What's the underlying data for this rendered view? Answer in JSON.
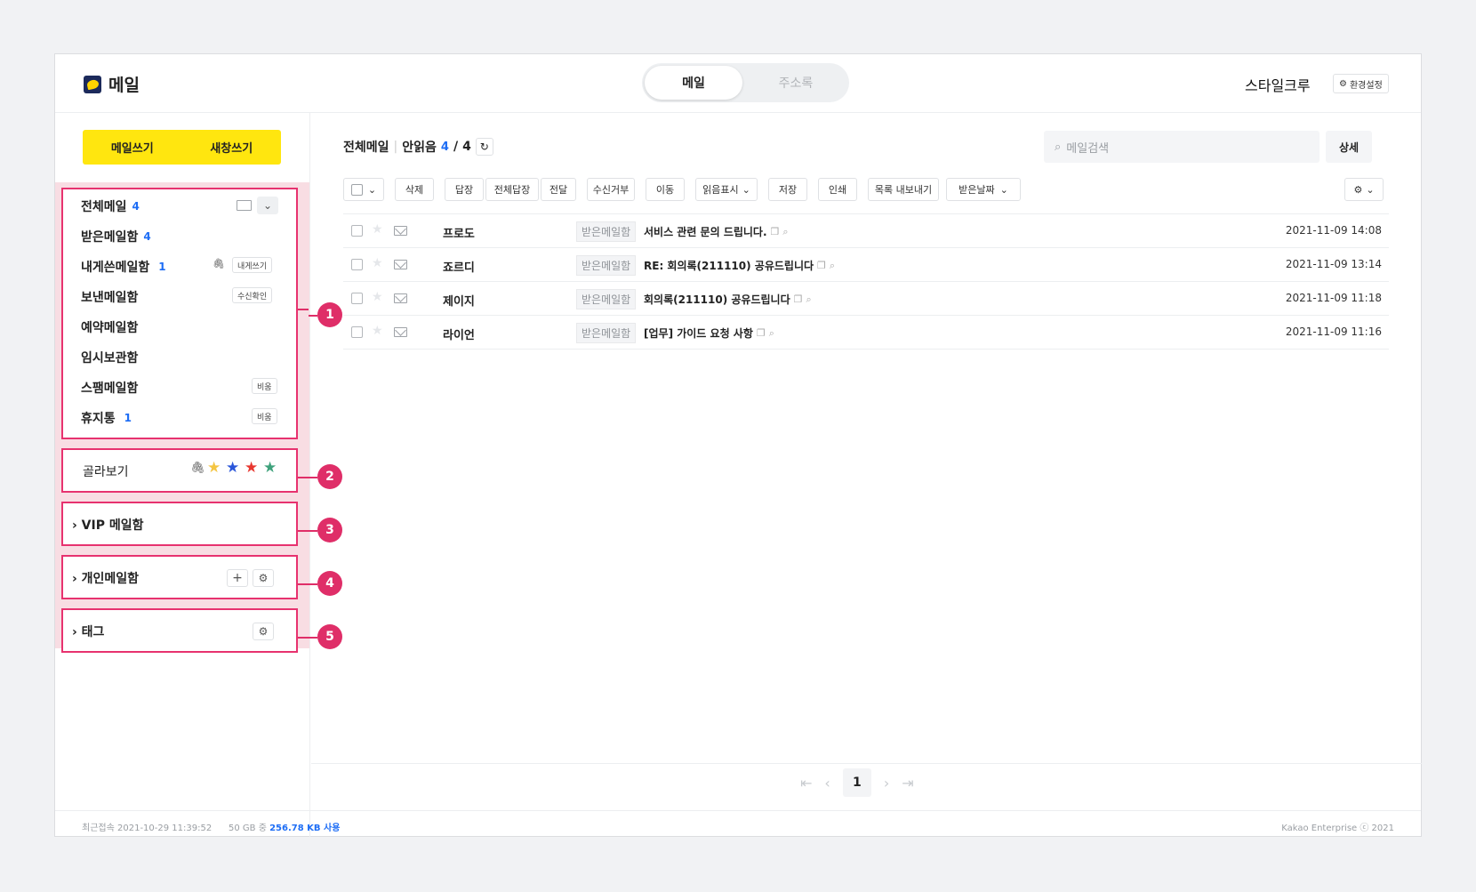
{
  "app": {
    "title": "메일"
  },
  "topnav": {
    "tab_active": "메일",
    "tab_inactive": "주소록"
  },
  "user": {
    "name": "스타일크루",
    "settings_label": "환경설정"
  },
  "compose": {
    "write": "메일쓰기",
    "popup": "새창쓰기"
  },
  "folders": [
    {
      "label": "전체메일",
      "count": "4"
    },
    {
      "label": "받은메일함",
      "count": "4"
    },
    {
      "label": "내게쓴메일함",
      "count": "1",
      "chip": "내게쓰기"
    },
    {
      "label": "보낸메일함",
      "count": "",
      "chip": "수신확인"
    },
    {
      "label": "예약메일함",
      "count": ""
    },
    {
      "label": "임시보관함",
      "count": ""
    },
    {
      "label": "스팸메일함",
      "count": "",
      "chip": "비움"
    },
    {
      "label": "휴지통",
      "count": "1",
      "chip": "비움"
    }
  ],
  "filter": {
    "label": "골라보기"
  },
  "sections": {
    "vip": "VIP 메일함",
    "personal": "개인메일함",
    "tag": "태그"
  },
  "callouts": [
    "1",
    "2",
    "3",
    "4",
    "5"
  ],
  "list_header": {
    "title": "전체메일",
    "unread_label": "안읽음",
    "unread": "4",
    "total": "4"
  },
  "search": {
    "placeholder": "메일검색",
    "detail": "상세"
  },
  "toolbar": [
    "삭제",
    "답장",
    "전체답장",
    "전달",
    "수신거부",
    "이동",
    "읽음표시",
    "저장",
    "인쇄",
    "목록 내보내기",
    "받은날짜"
  ],
  "mails": [
    {
      "sender": "프로도",
      "folder": "받은메일함",
      "subject": "서비스 관련 문의 드립니다.",
      "date": "2021-11-09 14:08"
    },
    {
      "sender": "죠르디",
      "folder": "받은메일함",
      "subject": "RE: 회의록(211110) 공유드립니다",
      "date": "2021-11-09 13:14"
    },
    {
      "sender": "제이지",
      "folder": "받은메일함",
      "subject": "회의록(211110) 공유드립니다",
      "date": "2021-11-09 11:18"
    },
    {
      "sender": "라이언",
      "folder": "받은메일함",
      "subject": "[업무] 가이드 요청 사항",
      "date": "2021-11-09 11:16"
    }
  ],
  "pagination": {
    "current": "1"
  },
  "footer": {
    "last_login_label": "최근접속",
    "last_login": "2021-10-29 11:39:52",
    "quota_prefix": "50 GB 중",
    "quota_used": "256.78 KB 사용",
    "copyright": "Kakao Enterprise ⓒ 2021"
  },
  "colors": {
    "accent": "#ffe60f",
    "callout": "#df2e68",
    "count": "#1d6df5",
    "highlight_zone": "#f8dde3"
  }
}
